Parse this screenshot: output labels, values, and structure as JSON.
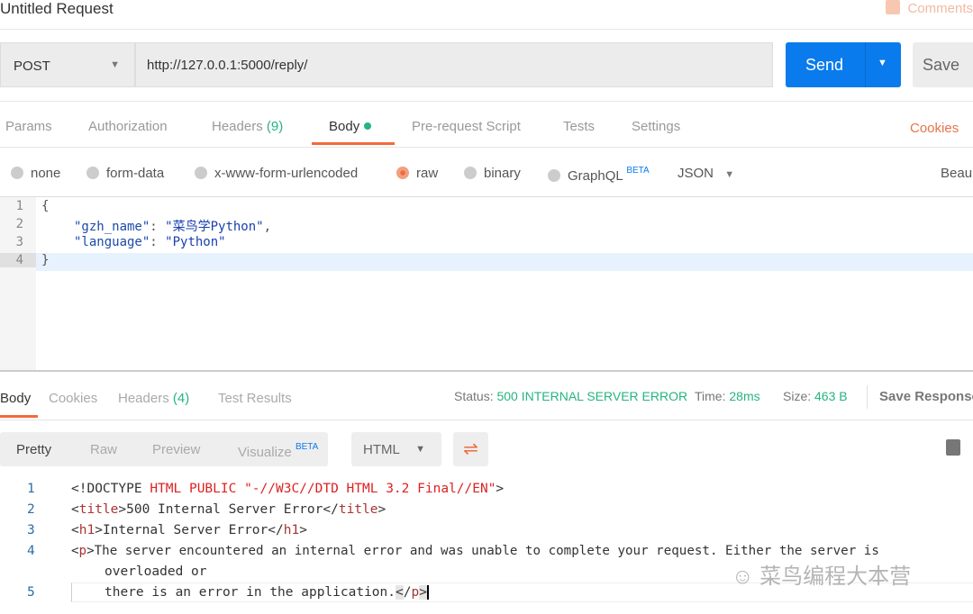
{
  "header": {
    "title": "Untitled Request",
    "comments": "Comments"
  },
  "request": {
    "method": "POST",
    "url": "http://127.0.0.1:5000/reply/",
    "send": "Send",
    "save": "Save"
  },
  "tabs": [
    {
      "label": "Params"
    },
    {
      "label": "Authorization"
    },
    {
      "label": "Headers",
      "count": "(9)"
    },
    {
      "label": "Body"
    },
    {
      "label": "Pre-request Script"
    },
    {
      "label": "Tests"
    },
    {
      "label": "Settings"
    }
  ],
  "cookies": "Cookies",
  "body_types": {
    "none": "none",
    "form_data": "form-data",
    "urlencoded": "x-www-form-urlencoded",
    "raw": "raw",
    "binary": "binary",
    "graphql": "GraphQL",
    "beta": "BETA",
    "format": "JSON",
    "beautify": "Beau"
  },
  "editor": {
    "line_numbers": [
      "1",
      "2",
      "3",
      "4"
    ],
    "lines": [
      "{",
      "\"gzh_name\": \"菜鸟学Python\",",
      "\"language\": \"Python\"",
      "}"
    ],
    "k1": "\"gzh_name\"",
    "v1": "\"菜鸟学Python\"",
    "k2": "\"language\"",
    "v2": "\"Python\""
  },
  "response": {
    "tabs": [
      "Body",
      "Cookies",
      "Headers",
      "Test Results"
    ],
    "headers_count": "(4)",
    "status_label": "Status:",
    "status": "500 INTERNAL SERVER ERROR",
    "time_label": "Time:",
    "time": "28ms",
    "size_label": "Size:",
    "size": "463 B",
    "save_response": "Save Response",
    "views": [
      "Pretty",
      "Raw",
      "Preview",
      "Visualize"
    ],
    "beta": "BETA",
    "format": "HTML",
    "line_numbers": [
      "1",
      "2",
      "3",
      "4",
      "5"
    ],
    "code": {
      "l1a": "<!DOCTYPE ",
      "l1b": "HTML PUBLIC \"-//W3C//DTD HTML 3.2 Final//EN\"",
      "l1c": ">",
      "l2": "500 Internal Server Error",
      "l3": "Internal Server Error",
      "l4": "The server encountered an internal error and was unable to complete your request. Either the server is",
      "l4b": "overloaded or",
      "l5": "there is an error in the application."
    }
  },
  "watermark": "菜鸟编程大本营"
}
